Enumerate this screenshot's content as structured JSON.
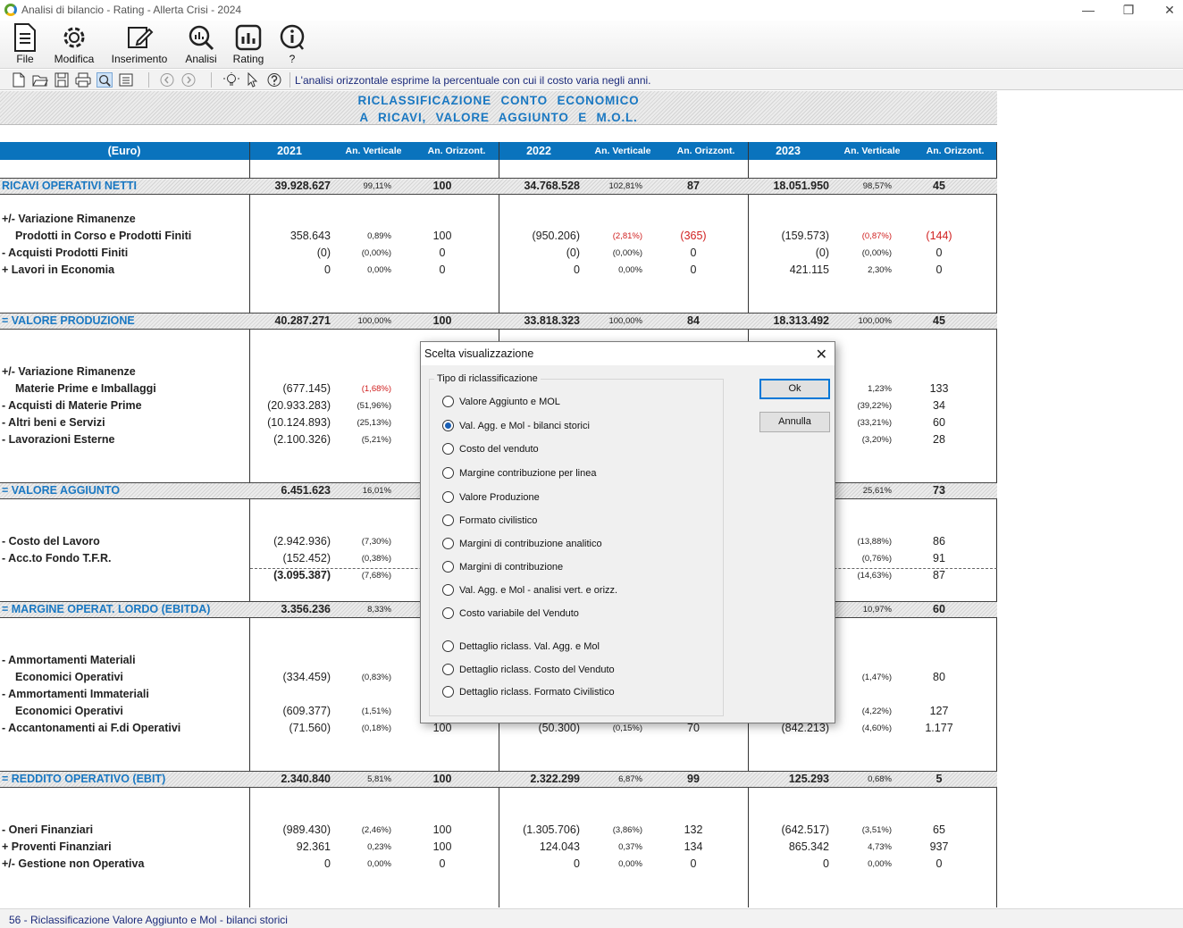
{
  "window": {
    "title": "Analisi di bilancio - Rating - Allerta Crisi - 2024"
  },
  "ribbon": [
    {
      "label": "File",
      "icon": "file-icon"
    },
    {
      "label": "Modifica",
      "icon": "gear-icon"
    },
    {
      "label": "Inserimento",
      "icon": "edit-icon"
    },
    {
      "label": "Analisi",
      "icon": "magnifier-chart-icon"
    },
    {
      "label": "Rating",
      "icon": "bar-chart-icon"
    },
    {
      "label": "?",
      "icon": "info-icon"
    }
  ],
  "toolbar": {
    "hint": "L'analisi orizzontale esprime la percentuale con cui il costo varia negli anni."
  },
  "report": {
    "title1": "RICLASSIFICAZIONE CONTO ECONOMICO",
    "title2": "A RICAVI, VALORE AGGIUNTO E M.O.L.",
    "currency": "(Euro)",
    "years": [
      "2021",
      "2022",
      "2023"
    ],
    "vert": "An. Verticale",
    "oriz": "An. Orizzont."
  },
  "rows": [
    {
      "label": "RICAVI OPERATIVI NETTI",
      "band": true,
      "y": [
        [
          "39.928.627",
          "99,11%",
          "100"
        ],
        [
          "34.768.528",
          "102,81%",
          "87"
        ],
        [
          "18.051.950",
          "98,57%",
          "45"
        ]
      ]
    },
    {
      "label": "+/- Variazione Rimanenze"
    },
    {
      "label": "Prodotti in Corso e Prodotti Finiti",
      "indent": true,
      "y": [
        [
          "358.643",
          "0,89%",
          "100"
        ],
        [
          "(950.206)",
          "(2,81%)",
          "(365)"
        ],
        [
          "(159.573)",
          "(0,87%)",
          "(144)"
        ]
      ]
    },
    {
      "label": "- Acquisti Prodotti Finiti",
      "y": [
        [
          "(0)",
          "(0,00%)",
          "0"
        ],
        [
          "(0)",
          "(0,00%)",
          "0"
        ],
        [
          "(0)",
          "(0,00%)",
          "0"
        ]
      ]
    },
    {
      "label": "+ Lavori in Economia",
      "y": [
        [
          "0",
          "0,00%",
          "0"
        ],
        [
          "0",
          "0,00%",
          "0"
        ],
        [
          "421.115",
          "2,30%",
          "0"
        ]
      ]
    },
    {
      "label": "= VALORE PRODUZIONE",
      "band": true,
      "y": [
        [
          "40.287.271",
          "100,00%",
          "100"
        ],
        [
          "33.818.323",
          "100,00%",
          "84"
        ],
        [
          "18.313.492",
          "100,00%",
          "45"
        ]
      ]
    },
    {
      "label": "+/- Variazione Rimanenze"
    },
    {
      "label": "Materie Prime e Imballaggi",
      "indent": true,
      "y": [
        [
          "(677.145)",
          "(1,68%)",
          ""
        ],
        [
          "",
          "",
          ""
        ],
        [
          "",
          "1,23%",
          "133"
        ]
      ]
    },
    {
      "label": "- Acquisti di Materie Prime",
      "y": [
        [
          "(20.933.283)",
          "(51,96%)",
          ""
        ],
        [
          "",
          "",
          ""
        ],
        [
          "",
          "(39,22%)",
          "34"
        ]
      ]
    },
    {
      "label": "- Altri beni e Servizi",
      "y": [
        [
          "(10.124.893)",
          "(25,13%)",
          ""
        ],
        [
          "",
          "",
          ""
        ],
        [
          "",
          "(33,21%)",
          "60"
        ]
      ]
    },
    {
      "label": "- Lavorazioni Esterne",
      "y": [
        [
          "(2.100.326)",
          "(5,21%)",
          ""
        ],
        [
          "",
          "",
          ""
        ],
        [
          "",
          "(3,20%)",
          "28"
        ]
      ]
    },
    {
      "label": "= VALORE AGGIUNTO",
      "band": true,
      "y": [
        [
          "6.451.623",
          "16,01%",
          ""
        ],
        [
          "",
          "",
          ""
        ],
        [
          "",
          "25,61%",
          "73"
        ]
      ]
    },
    {
      "label": "- Costo del Lavoro",
      "y": [
        [
          "(2.942.936)",
          "(7,30%)",
          ""
        ],
        [
          "",
          "",
          ""
        ],
        [
          "",
          "(13,88%)",
          "86"
        ]
      ]
    },
    {
      "label": "- Acc.to Fondo T.F.R.",
      "y": [
        [
          "(152.452)",
          "(0,38%)",
          ""
        ],
        [
          "",
          "",
          ""
        ],
        [
          "",
          "(0,76%)",
          "91"
        ]
      ]
    },
    {
      "label": "",
      "total": true,
      "y": [
        [
          "(3.095.387)",
          "(7,68%)",
          ""
        ],
        [
          "",
          "",
          ""
        ],
        [
          "",
          "(14,63%)",
          "87"
        ]
      ]
    },
    {
      "label": "= MARGINE OPERAT. LORDO (EBITDA)",
      "band": true,
      "y": [
        [
          "3.356.236",
          "8,33%",
          ""
        ],
        [
          "",
          "",
          ""
        ],
        [
          "",
          "10,97%",
          "60"
        ]
      ]
    },
    {
      "label": "- Ammortamenti Materiali"
    },
    {
      "label": "Economici Operativi",
      "indent": true,
      "y": [
        [
          "(334.459)",
          "(0,83%)",
          ""
        ],
        [
          "",
          "",
          ""
        ],
        [
          "",
          "(1,47%)",
          "80"
        ]
      ]
    },
    {
      "label": "- Ammortamenti Immateriali"
    },
    {
      "label": "Economici Operativi",
      "indent": true,
      "y": [
        [
          "(609.377)",
          "(1,51%)",
          ""
        ],
        [
          "",
          "",
          ""
        ],
        [
          "",
          "(4,22%)",
          "127"
        ]
      ]
    },
    {
      "label": "- Accantonamenti ai F.di Operativi",
      "y": [
        [
          "(71.560)",
          "(0,18%)",
          "100"
        ],
        [
          "(50.300)",
          "(0,15%)",
          "70"
        ],
        [
          "(842.213)",
          "(4,60%)",
          "1.177"
        ]
      ]
    },
    {
      "label": "= REDDITO OPERATIVO (EBIT)",
      "band": true,
      "y": [
        [
          "2.340.840",
          "5,81%",
          "100"
        ],
        [
          "2.322.299",
          "6,87%",
          "99"
        ],
        [
          "125.293",
          "0,68%",
          "5"
        ]
      ]
    },
    {
      "label": "- Oneri Finanziari",
      "y": [
        [
          "(989.430)",
          "(2,46%)",
          "100"
        ],
        [
          "(1.305.706)",
          "(3,86%)",
          "132"
        ],
        [
          "(642.517)",
          "(3,51%)",
          "65"
        ]
      ]
    },
    {
      "label": "+ Proventi Finanziari",
      "y": [
        [
          "92.361",
          "0,23%",
          "100"
        ],
        [
          "124.043",
          "0,37%",
          "134"
        ],
        [
          "865.342",
          "4,73%",
          "937"
        ]
      ]
    },
    {
      "label": "+/- Gestione non Operativa",
      "y": [
        [
          "0",
          "0,00%",
          "0"
        ],
        [
          "0",
          "0,00%",
          "0"
        ],
        [
          "0",
          "0,00%",
          "0"
        ]
      ]
    }
  ],
  "dialog": {
    "title": "Scelta visualizzazione",
    "group_label": "Tipo di riclassificazione",
    "options": [
      "Valore Aggiunto e MOL",
      "Val. Agg. e Mol - bilanci storici",
      "Costo del venduto",
      "Margine contribuzione per linea",
      "Valore Produzione",
      "Formato civilistico",
      "Margini di contribuzione analitico",
      "Margini di contribuzione",
      "Val. Agg. e Mol - analisi vert. e orizz.",
      "Costo variabile del Venduto",
      "Dettaglio riclass. Val. Agg. e Mol",
      "Dettaglio riclass. Costo del Venduto",
      "Dettaglio riclass. Formato Civilistico"
    ],
    "selected": 1,
    "ok_label": "Ok",
    "cancel_label": "Annulla"
  },
  "status": {
    "text": "56 - Riclassificazione Valore Aggiunto e Mol - bilanci storici"
  },
  "colors": {
    "header_blue": "#0a73bd",
    "label_blue": "#1a78c2",
    "negative_red": "#d02020"
  }
}
